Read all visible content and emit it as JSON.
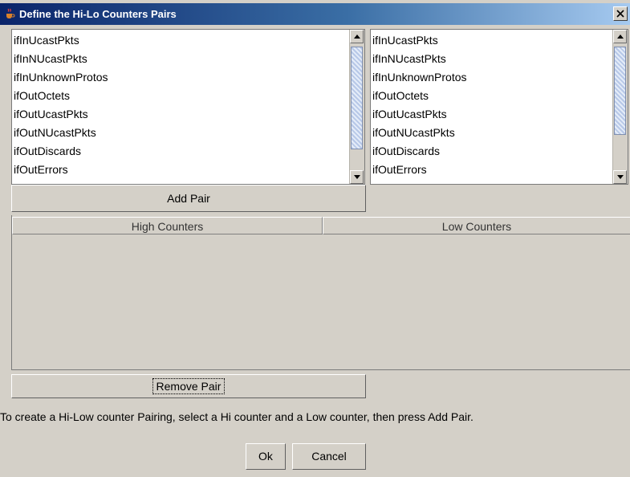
{
  "window": {
    "title": "Define the Hi-Lo Counters Pairs",
    "close_symbol": "x"
  },
  "high_list": {
    "items": [
      "ifInUcastPkts",
      "ifInNUcastPkts",
      "ifInUnknownProtos",
      "ifOutOctets",
      "ifOutUcastPkts",
      "ifOutNUcastPkts",
      "ifOutDiscards",
      "ifOutErrors"
    ]
  },
  "low_list": {
    "items": [
      "ifInUcastPkts",
      "ifInNUcastPkts",
      "ifInUnknownProtos",
      "ifOutOctets",
      "ifOutUcastPkts",
      "ifOutNUcastPkts",
      "ifOutDiscards",
      "ifOutErrors"
    ]
  },
  "buttons": {
    "add_pair": "Add Pair",
    "remove_pair": "Remove Pair",
    "ok": "Ok",
    "cancel": "Cancel"
  },
  "pairs_table": {
    "columns": [
      "High Counters",
      "Low Counters"
    ],
    "rows": []
  },
  "hint": "To create a Hi-Low counter Pairing, select a Hi counter and a Low counter, then press Add Pair.",
  "colors": {
    "title_bar_start": "#0a246a",
    "title_bar_end": "#a6caf0",
    "window_bg": "#d4d0c8",
    "scroll_thumb": "#b7c8e8"
  },
  "icons": {
    "title": "java-cup-icon",
    "close": "close-icon",
    "scroll_up": "scroll-up-arrow-icon",
    "scroll_down": "scroll-down-arrow-icon"
  }
}
